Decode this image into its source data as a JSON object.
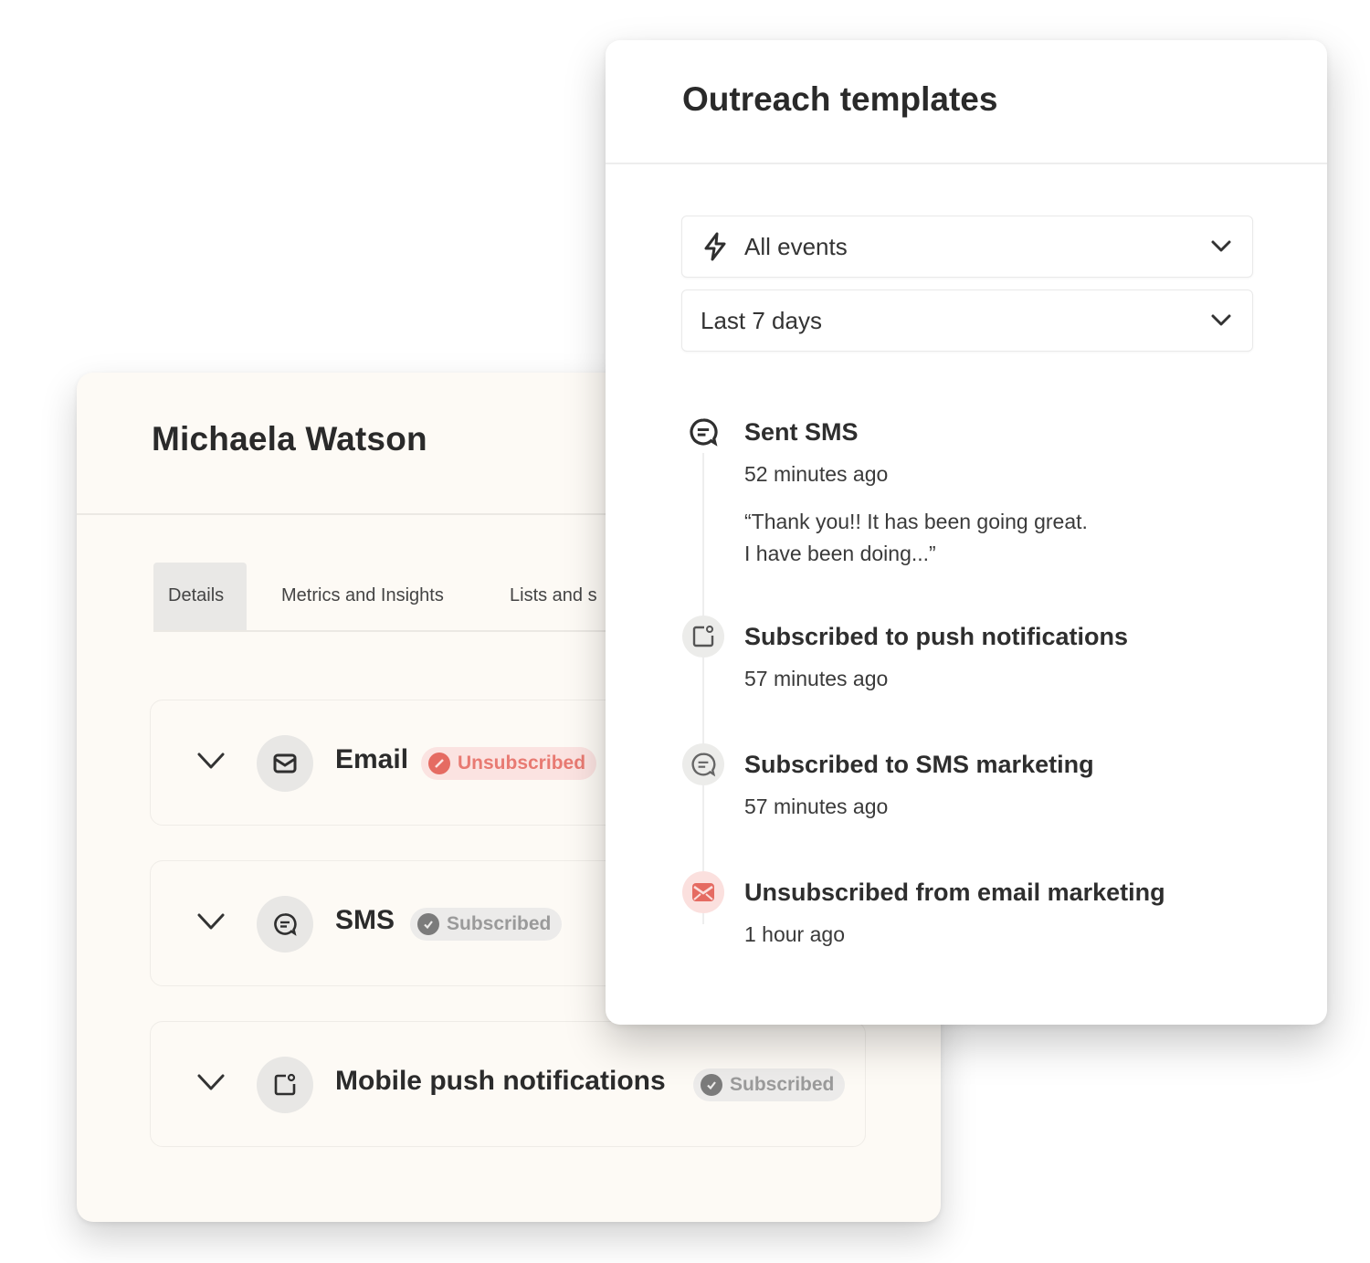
{
  "profile": {
    "name": "Michaela Watson",
    "tabs": [
      {
        "label": "Details",
        "active": true
      },
      {
        "label": "Metrics and Insights",
        "active": false
      },
      {
        "label": "Lists and s",
        "active": false
      }
    ],
    "channels": [
      {
        "label": "Email",
        "icon": "mail-icon",
        "status": "Unsubscribed",
        "status_type": "unsubscribed"
      },
      {
        "label": "SMS",
        "icon": "chat-icon",
        "status": "Subscribed",
        "status_type": "subscribed"
      },
      {
        "label": "Mobile push notifications",
        "icon": "mobile-push-icon",
        "status": "Subscribed",
        "status_type": "subscribed"
      }
    ]
  },
  "outreach": {
    "title": "Outreach templates",
    "event_filter": {
      "value": "All events",
      "icon": "bolt-icon"
    },
    "date_filter": {
      "value": "Last 7 days"
    },
    "events": [
      {
        "title": "Sent SMS",
        "time": "52 minutes ago",
        "quote_line1": "“Thank you!! It has been going great.",
        "quote_line2": "I have been doing...”",
        "icon": "chat-icon"
      },
      {
        "title": "Subscribed to push notifications",
        "time": "57 minutes ago",
        "icon": "mobile-push-icon"
      },
      {
        "title": "Subscribed to SMS marketing",
        "time": "57 minutes ago",
        "icon": "chat-icon"
      },
      {
        "title": "Unsubscribed from email marketing",
        "time": "1 hour ago",
        "icon": "mail-icon"
      }
    ]
  },
  "colors": {
    "unsubscribed": "#e56b62",
    "unsubscribed_bg": "#fbe3e1",
    "subscribed": "#7b7b7b",
    "card_bg": "#fdfaf5"
  }
}
